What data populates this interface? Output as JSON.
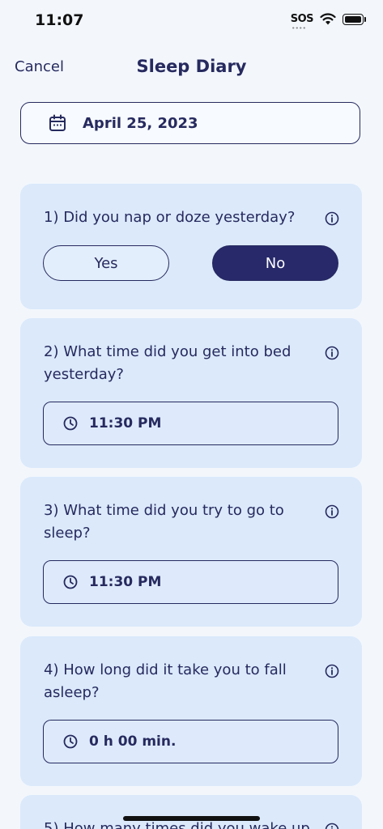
{
  "status": {
    "time": "11:07",
    "sos": "SOS"
  },
  "nav": {
    "cancel": "Cancel",
    "title": "Sleep Diary"
  },
  "date": {
    "value": "April 25, 2023"
  },
  "questions": [
    {
      "text": "1) Did you nap or doze yesterday?",
      "options": [
        "Yes",
        "No"
      ],
      "selected": "No"
    },
    {
      "text": "2) What time did you get into bed yesterday?",
      "value": "11:30 PM"
    },
    {
      "text": "3) What time did you try to go to sleep?",
      "value": "11:30 PM"
    },
    {
      "text": "4) How long did it take you to fall asleep?",
      "value": "0 h 00 min."
    },
    {
      "text": "5) How many times did you wake up"
    }
  ],
  "colors": {
    "primary": "#27296a",
    "card": "#dbe9fb",
    "background": "#f3f7fc"
  },
  "icons": {
    "date": "calendar-icon",
    "time": "clock-icon",
    "help": "info-icon"
  }
}
